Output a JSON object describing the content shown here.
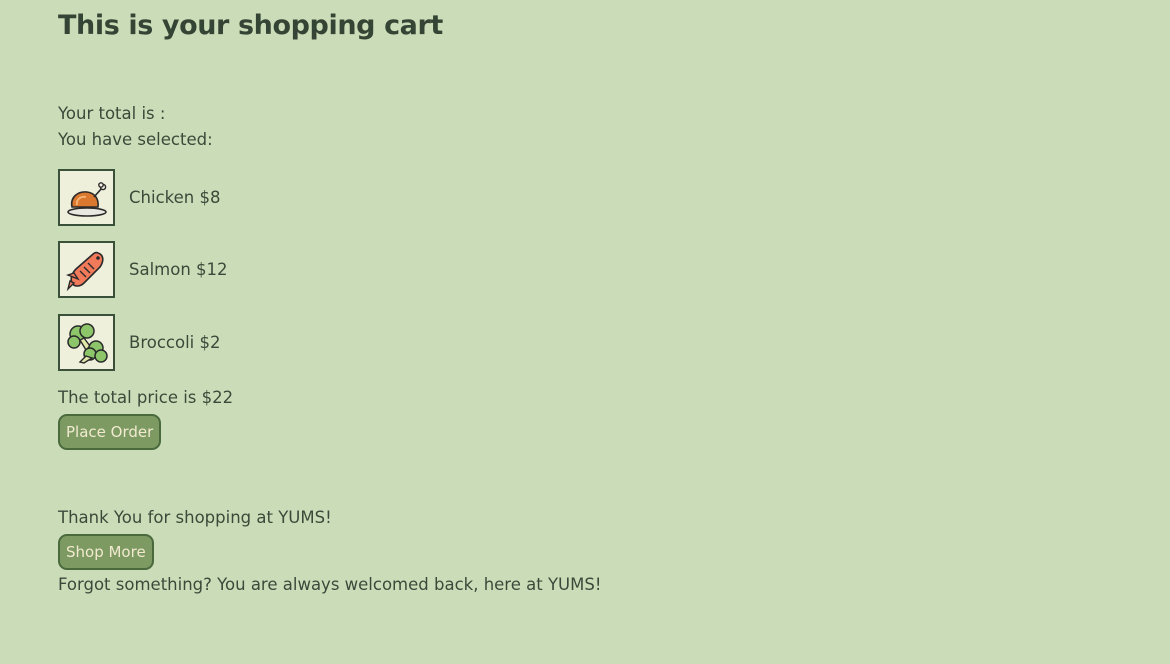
{
  "title": "This is your shopping cart",
  "total_label": "Your total is :",
  "selected_label": "You have selected:",
  "items": [
    {
      "icon": "chicken-icon",
      "label": "Chicken $8"
    },
    {
      "icon": "salmon-icon",
      "label": "Salmon $12"
    },
    {
      "icon": "broccoli-icon",
      "label": "Broccoli $2"
    }
  ],
  "total_price_text": "The total price is $22",
  "place_order_label": "Place Order",
  "thank_you_text": "Thank You for shopping at YUMS!",
  "shop_more_label": "Shop More",
  "forgot_text": "Forgot something? You are always welcomed back, here at YUMS!",
  "colors": {
    "background": "#cbddb8",
    "button_fill": "#7c9a62",
    "button_text": "#f2ead0",
    "border": "#3b5038"
  }
}
